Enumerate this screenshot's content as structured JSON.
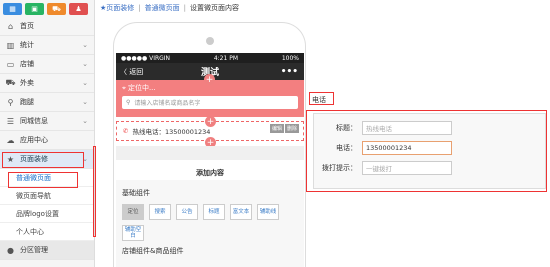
{
  "sidebar": {
    "top_icons": [
      {
        "icon": "grid-icon",
        "color": "#3a8de0",
        "glyph": "▦"
      },
      {
        "icon": "folder-icon",
        "color": "#28b463",
        "glyph": "▣"
      },
      {
        "icon": "cart-icon",
        "color": "#ef8a2c",
        "glyph": "⛟"
      },
      {
        "icon": "shirt-icon",
        "color": "#e05050",
        "glyph": "♟"
      }
    ],
    "items": [
      {
        "label": "首页",
        "icon": "home-icon",
        "glyph": "⌂",
        "chev": ""
      },
      {
        "label": "统计",
        "icon": "chart-icon",
        "glyph": "▥",
        "chev": "⌄"
      },
      {
        "label": "店铺",
        "icon": "monitor-icon",
        "glyph": "▭",
        "chev": "⌄"
      },
      {
        "label": "外卖",
        "icon": "truck-icon",
        "glyph": "⛟",
        "chev": "⌄"
      },
      {
        "label": "跑腿",
        "icon": "bike-icon",
        "glyph": "⚲",
        "chev": "⌄"
      },
      {
        "label": "同城信息",
        "icon": "list-icon",
        "glyph": "☰",
        "chev": "⌄"
      },
      {
        "label": "应用中心",
        "icon": "cloud-icon",
        "glyph": "☁",
        "chev": ""
      },
      {
        "label": "页面装修",
        "icon": "star-icon",
        "glyph": "★",
        "chev": "⌄"
      }
    ],
    "sub_items": [
      "普通微页面",
      "微页面导航",
      "品牌logo设置",
      "个人中心"
    ],
    "bottom_item": {
      "label": "分区管理",
      "icon": "circle-icon",
      "glyph": "●"
    }
  },
  "breadcrumb": {
    "home": "页面装修",
    "level2": "普通微页面",
    "current": "设置微页面内容"
  },
  "phone": {
    "status_left": "●●●●● VIRGIN",
    "status_time": "4:21 PM",
    "status_right": "100%",
    "back": "〈 返回",
    "title": "测试",
    "more": "•••",
    "location": "定位中...",
    "search_placeholder": "请输入店铺名或商品名字",
    "phone_row": "热线电话：13500001234",
    "edit_btns": [
      "编辑",
      "删除"
    ],
    "add_content": "添加内容"
  },
  "components": {
    "basic_title": "基础组件",
    "buttons": [
      "定位",
      "搜索",
      "公告",
      "标题",
      "富文本",
      "辅助线",
      "辅助空白"
    ],
    "shop_title": "店铺组件&商品组件"
  },
  "panel": {
    "title": "电话",
    "fields": [
      {
        "label": "标题：",
        "value": "热线电话",
        "filled": false
      },
      {
        "label": "电话：",
        "value": "13500001234",
        "filled": true
      },
      {
        "label": "拨打提示：",
        "value": "一键拨打",
        "filled": false
      }
    ]
  }
}
